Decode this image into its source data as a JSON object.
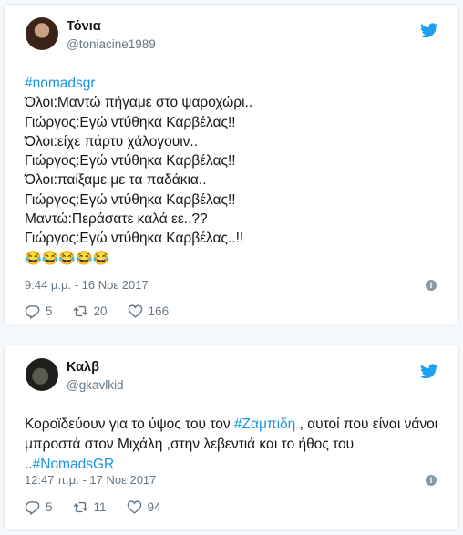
{
  "tweets": [
    {
      "name": "Τόνια",
      "handle": "@toniacine1989",
      "lines": [
        {
          "text": "#nomadsgr",
          "link": true
        },
        {
          "text": "Όλοι:Μαντώ πήγαμε στο ψαροχώρι..",
          "link": false
        },
        {
          "text": "Γιώργος:Εγώ ντύθηκα Καρβέλας!!",
          "link": false
        },
        {
          "text": "Όλοι:είχε πάρτυ χάλογουιν..",
          "link": false
        },
        {
          "text": "Γιώργος:Εγώ ντύθηκα Καρβέλας!!",
          "link": false
        },
        {
          "text": "Όλοι:παίξαμε με τα παδάκια..",
          "link": false
        },
        {
          "text": "Γιώργος:Εγώ ντύθηκα Καρβέλας!!",
          "link": false
        },
        {
          "text": "Μαντώ:Περάσατε καλά εε..??",
          "link": false
        },
        {
          "text": "Γιώργος:Εγώ ντύθηκα Καρβέλας..!!",
          "link": false
        }
      ],
      "emojis": "😂😂😂😂😂",
      "timestamp": "9:44 μ.μ. - 16 Νοε 2017",
      "replies": "5",
      "retweets": "20",
      "likes": "166"
    },
    {
      "name": "Καλβ",
      "handle": "@gkavlkid",
      "body_pre": "Κοροϊδεύουν για το ύψος του τον ",
      "body_link1": "#Ζαμπιδη",
      "body_mid": " , αυτοί που είναι νάνοι μπροστά στον Μιχάλη ,στην λεβεντιά και το ήθος του ..",
      "body_link2": "#NomadsGR",
      "timestamp": "12:47 π.μ. - 17 Νοε 2017",
      "replies": "5",
      "retweets": "11",
      "likes": "94"
    }
  ],
  "colors": {
    "link": "#1b95e0",
    "muted": "#657786",
    "border": "#e1e8ed",
    "twitter_blue": "#1da1f2"
  },
  "icons": [
    "twitter-bird-icon",
    "info-icon",
    "reply-icon",
    "retweet-icon",
    "like-icon"
  ]
}
